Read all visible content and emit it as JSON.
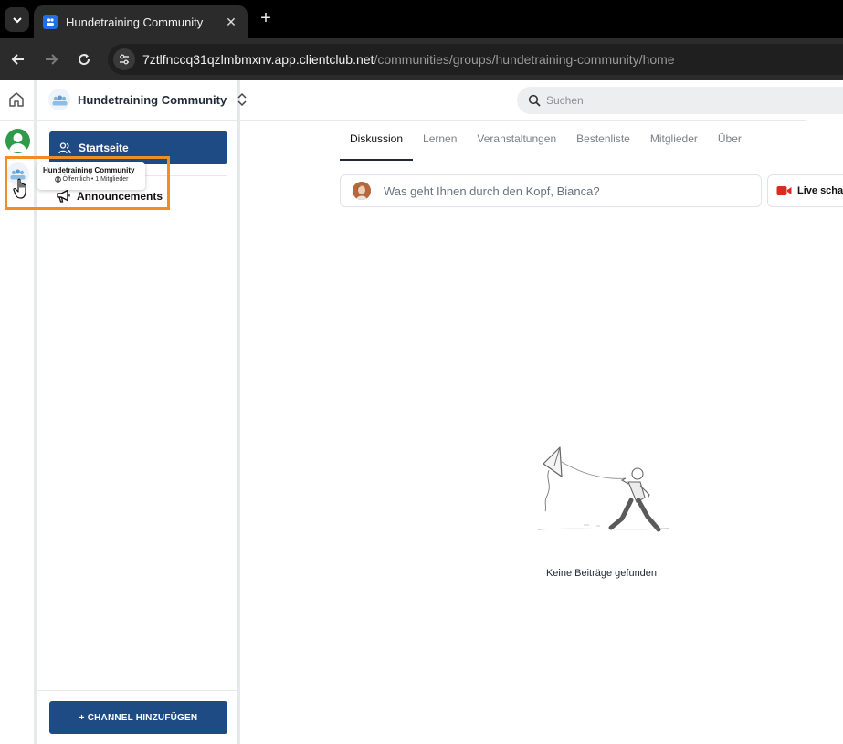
{
  "browser": {
    "tab_title": "Hundetraining Community",
    "url_host": "7ztlfnccq31qzlmbmxnv.app.clientclub.net",
    "url_path": "/communities/groups/hundetraining-community/home"
  },
  "header": {
    "community_name": "Hundetraining Community",
    "search_placeholder": "Suchen"
  },
  "tooltip": {
    "title": "Hundetraining Community",
    "subtitle": "Öffentlich • 1 Mitglieder"
  },
  "sidebar": {
    "home_label": "Startseite",
    "channel_label": "Announcements",
    "add_channel_label": "+ CHANNEL HINZUFÜGEN"
  },
  "tabs": [
    "Diskussion",
    "Lernen",
    "Veranstaltungen",
    "Bestenliste",
    "Mitglieder",
    "Über"
  ],
  "composer": {
    "placeholder": "Was geht Ihnen durch den Kopf, Bianca?",
    "live_label": "Live schalt"
  },
  "empty_state": {
    "message": "Keine Beiträge gefunden"
  },
  "colors": {
    "primary": "#1e4b84",
    "highlight": "#f28c28",
    "live_red": "#d92d20",
    "avatar_green": "#2e9a4a"
  }
}
